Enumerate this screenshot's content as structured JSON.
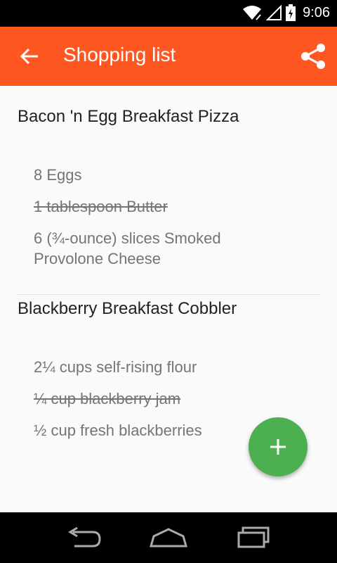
{
  "status_bar": {
    "time": "9:06"
  },
  "app_bar": {
    "title": "Shopping list"
  },
  "recipes": [
    {
      "title": "Bacon 'n Egg Breakfast Pizza",
      "items": [
        {
          "text": "8 Eggs",
          "checked": false
        },
        {
          "text": "1 tablespoon Butter",
          "checked": true
        },
        {
          "text": "6 (¾-ounce) slices Smoked Provolone Cheese",
          "checked": false
        }
      ]
    },
    {
      "title": "Blackberry Breakfast Cobbler",
      "items": [
        {
          "text": "2¼ cups self-rising flour",
          "checked": false
        },
        {
          "text": "¼ cup blackberry jam",
          "checked": true
        },
        {
          "text": "½ cup fresh blackberries",
          "checked": false
        }
      ]
    }
  ],
  "colors": {
    "app_bar": "#ff5722",
    "fab": "#4caf50"
  },
  "icons": {
    "back": "arrow-back-icon",
    "share": "share-icon",
    "fab": "plus-icon"
  }
}
